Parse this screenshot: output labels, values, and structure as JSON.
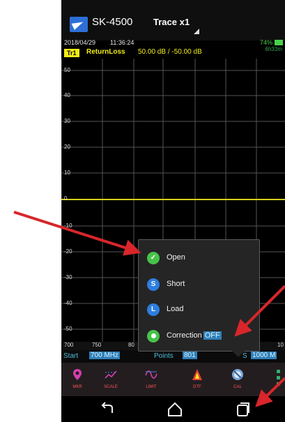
{
  "app": {
    "title": "SK-4500",
    "trace_selector": "Trace x1",
    "icon": "app-logo-icon"
  },
  "status": {
    "date": "2018/04/29",
    "time": "11:36:24",
    "battery": "74%",
    "runtime": "6h33m",
    "battery_color": "#49d14a"
  },
  "trace": {
    "badge": "Tr1",
    "measurement": "ReturnLoss",
    "values": "50.00 dB / -50.00 dB",
    "color": "#f2ec17"
  },
  "plot": {
    "y_ticks": [
      "50",
      "40",
      "30",
      "20",
      "10",
      "0",
      "-10",
      "-20",
      "-30",
      "-40",
      "-50"
    ],
    "x_ticks": [
      "700",
      "750",
      "80",
      "10"
    ],
    "grid_color": "#555555",
    "trace_color": "#d7d01a"
  },
  "freq": {
    "start_label": "Start",
    "start_value": "700 MHz",
    "points_label": "Points",
    "points_value": "801",
    "stop_label": "S",
    "stop_value": "1000 M",
    "label_color": "#4fbdd6",
    "value_bg": "#2f7fb8"
  },
  "toolbar": {
    "items": [
      {
        "label": "MKR",
        "icon": "marker-pin-icon"
      },
      {
        "label": "SCALE",
        "icon": "scale-icon"
      },
      {
        "label": "LIMIT",
        "icon": "limit-icon"
      },
      {
        "label": "DTF",
        "icon": "dtf-icon"
      },
      {
        "label": "CAL",
        "icon": "calibration-icon"
      }
    ],
    "more": "more-vert-icon",
    "label_color": "#ff5555"
  },
  "cal_menu": {
    "items": [
      {
        "key": "open",
        "label": "Open",
        "icon_letter": "",
        "icon_color": "#47c24a"
      },
      {
        "key": "short",
        "label": "Short",
        "icon_letter": "S",
        "icon_color": "#2d7ee0"
      },
      {
        "key": "load",
        "label": "Load",
        "icon_letter": "L",
        "icon_color": "#2d7ee0"
      },
      {
        "key": "correction",
        "label": "Correction",
        "icon_letter": "",
        "icon_color": "#47c24a",
        "status": "OFF"
      }
    ]
  },
  "nav": {
    "back": "back-icon",
    "home": "home-icon",
    "recents": "recents-icon"
  },
  "annotation_color": "#d8262b"
}
